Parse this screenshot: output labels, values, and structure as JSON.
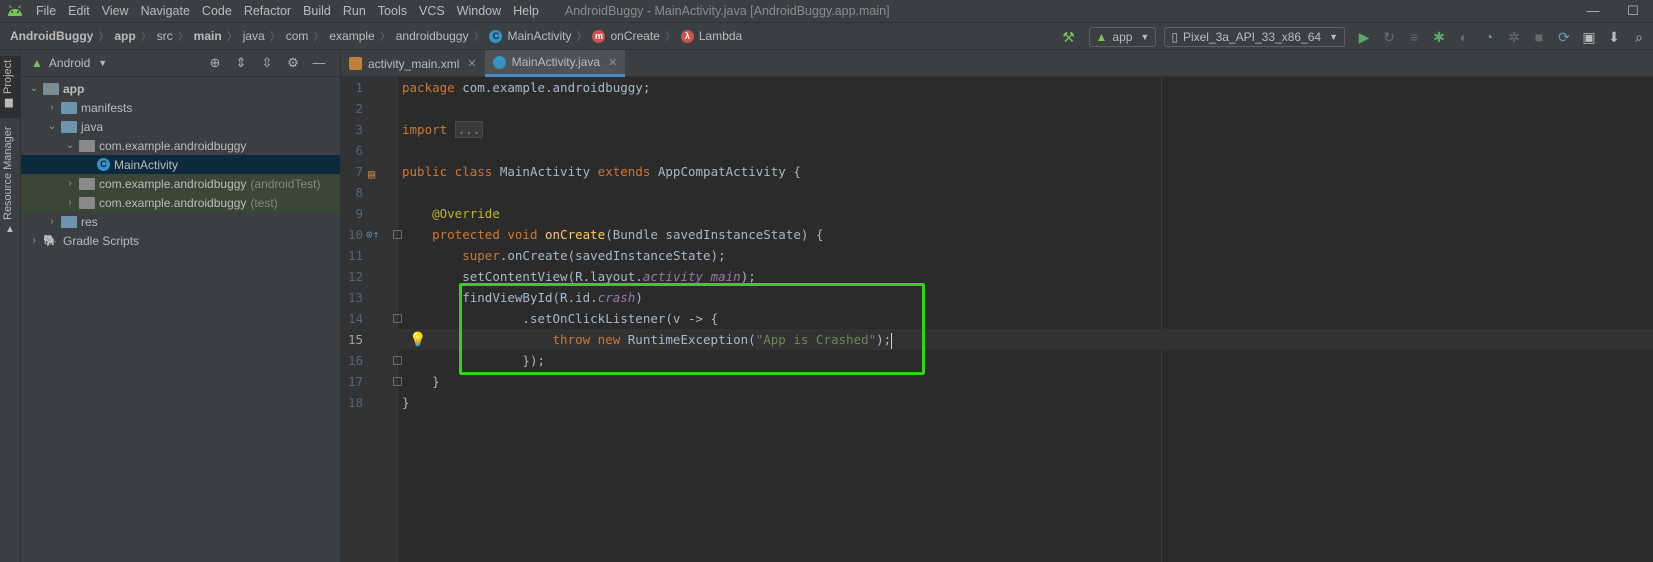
{
  "menu": {
    "items": [
      "File",
      "Edit",
      "View",
      "Navigate",
      "Code",
      "Refactor",
      "Build",
      "Run",
      "Tools",
      "VCS",
      "Window",
      "Help"
    ],
    "window_title": "AndroidBuggy - MainActivity.java [AndroidBuggy.app.main]"
  },
  "breadcrumbs": [
    "AndroidBuggy",
    "app",
    "src",
    "main",
    "java",
    "com",
    "example",
    "androidbuggy",
    "MainActivity",
    "onCreate",
    "Lambda"
  ],
  "toolbar": {
    "config": "app",
    "device": "Pixel_3a_API_33_x86_64"
  },
  "stripe": {
    "project": "Project",
    "resource_manager": "Resource Manager"
  },
  "project_panel": {
    "view": "Android",
    "tree": [
      {
        "label": "app"
      },
      {
        "label": "manifests"
      },
      {
        "label": "java"
      },
      {
        "label": "com.example.androidbuggy"
      },
      {
        "label": "MainActivity"
      },
      {
        "label": "com.example.androidbuggy",
        "suffix": "(androidTest)"
      },
      {
        "label": "com.example.androidbuggy",
        "suffix": "(test)"
      },
      {
        "label": "res"
      },
      {
        "label": "Gradle Scripts"
      }
    ]
  },
  "tabs": [
    {
      "label": "activity_main.xml"
    },
    {
      "label": "MainActivity.java"
    }
  ],
  "editor": {
    "line_numbers": [
      "1",
      "2",
      "3",
      "6",
      "7",
      "8",
      "9",
      "10",
      "11",
      "12",
      "13",
      "14",
      "15",
      "16",
      "17",
      "18"
    ],
    "lines": {
      "l1_kw": "package",
      "l1_rest": " com.example.androidbuggy;",
      "l3_kw": "import",
      "l3_fold": "...",
      "l7_kw1": "public class",
      "l7_name": " MainActivity ",
      "l7_kw2": "extends",
      "l7_rest": " AppCompatActivity {",
      "l9": "@Override",
      "l10_kw": "protected void",
      "l10_fn": "onCreate",
      "l10_rest": "(Bundle savedInstanceState) {",
      "l11_kw": "super",
      "l11_rest": ".onCreate(savedInstanceState);",
      "l12_a": "setContentView(R.layout.",
      "l12_b": "activity_main",
      "l12_c": ");",
      "l13_a": "findViewById(R.id.",
      "l13_b": "crash",
      "l13_c": ")",
      "l14": ".setOnClickListener(v -> {",
      "l15_kw": "throw new",
      "l15_a": " RuntimeException(",
      "l15_str": "\"App is Crashed\"",
      "l15_c": ");",
      "l16": "});",
      "l17": "}",
      "l18": "}"
    }
  }
}
